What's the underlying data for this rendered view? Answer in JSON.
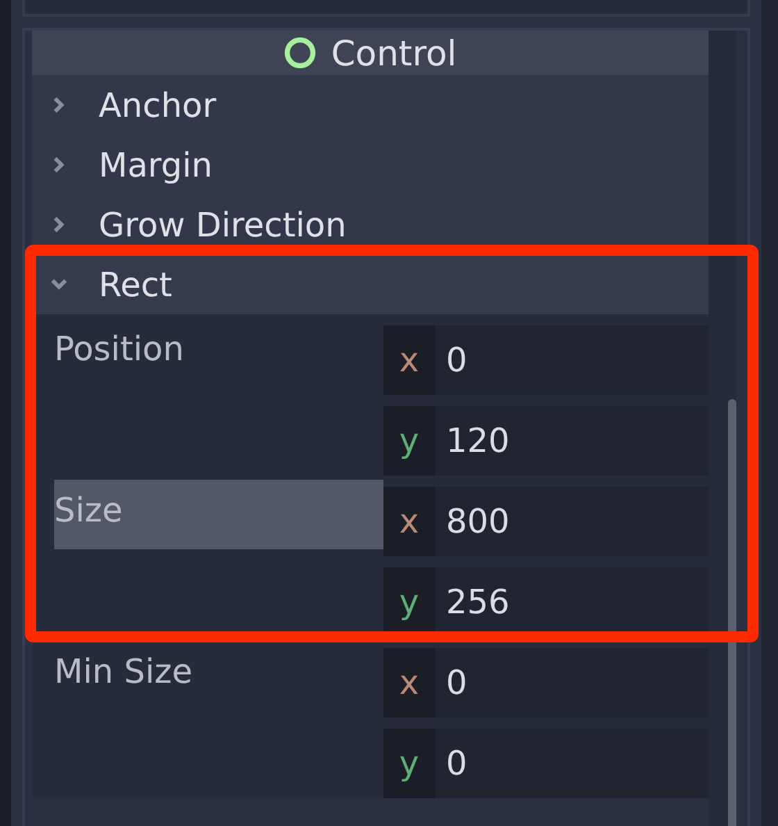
{
  "header": {
    "title": "Control"
  },
  "sections": [
    {
      "label": "Anchor",
      "expanded": false
    },
    {
      "label": "Margin",
      "expanded": false
    },
    {
      "label": "Grow Direction",
      "expanded": false
    },
    {
      "label": "Rect",
      "expanded": true,
      "properties": [
        {
          "label": "Position",
          "selected": false,
          "fields": [
            {
              "axis": "x",
              "value": "0"
            },
            {
              "axis": "y",
              "value": "120"
            }
          ]
        },
        {
          "label": "Size",
          "selected": true,
          "fields": [
            {
              "axis": "x",
              "value": "800"
            },
            {
              "axis": "y",
              "value": "256"
            }
          ]
        },
        {
          "label": "Min Size",
          "selected": false,
          "fields": [
            {
              "axis": "x",
              "value": "0"
            },
            {
              "axis": "y",
              "value": "0"
            }
          ]
        }
      ]
    }
  ]
}
